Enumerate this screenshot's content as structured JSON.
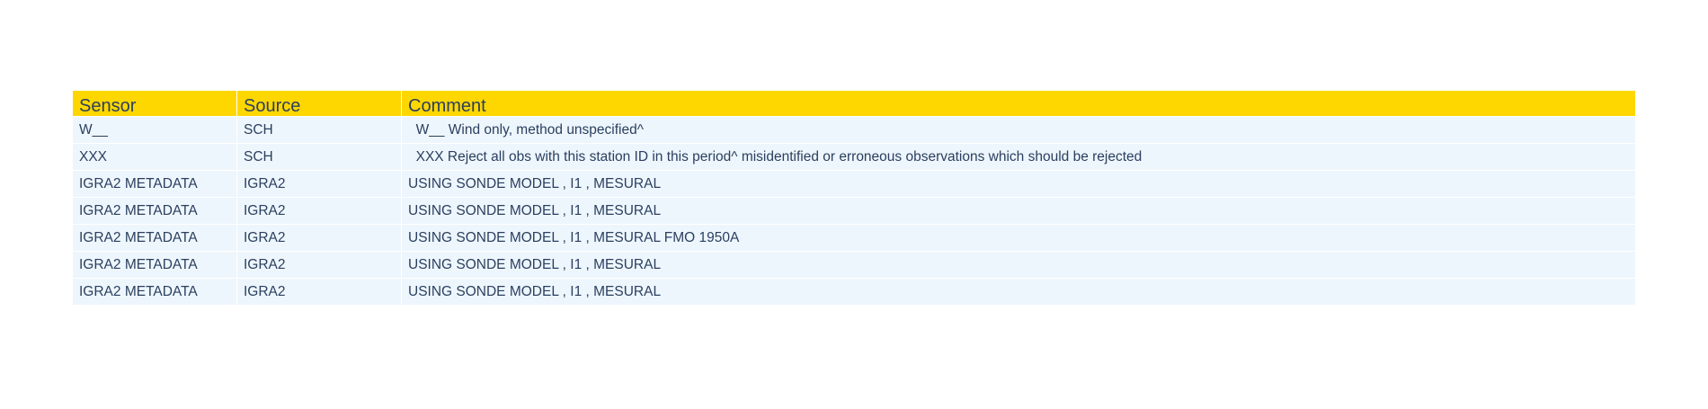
{
  "table": {
    "headers": [
      "Sensor",
      "Source",
      "Comment"
    ],
    "rows": [
      [
        "W__",
        "SCH",
        "  W__ Wind only, method unspecified^"
      ],
      [
        "XXX",
        "SCH",
        "  XXX Reject all obs with this station ID in this period^ misidentified or erroneous observations which should be rejected"
      ],
      [
        "IGRA2 METADATA",
        "IGRA2",
        "USING SONDE MODEL , I1 , MESURAL"
      ],
      [
        "IGRA2 METADATA",
        "IGRA2",
        "USING SONDE MODEL , I1 , MESURAL"
      ],
      [
        "IGRA2 METADATA",
        "IGRA2",
        "USING SONDE MODEL , I1 , MESURAL FMO 1950A"
      ],
      [
        "IGRA2 METADATA",
        "IGRA2",
        "USING SONDE MODEL , I1 , MESURAL"
      ],
      [
        "IGRA2 METADATA",
        "IGRA2",
        "USING SONDE MODEL , I1 , MESURAL"
      ]
    ]
  },
  "colors": {
    "header_bg": "#ffd700",
    "cell_bg": "#eef6fd",
    "text": "#2a3f5f"
  }
}
